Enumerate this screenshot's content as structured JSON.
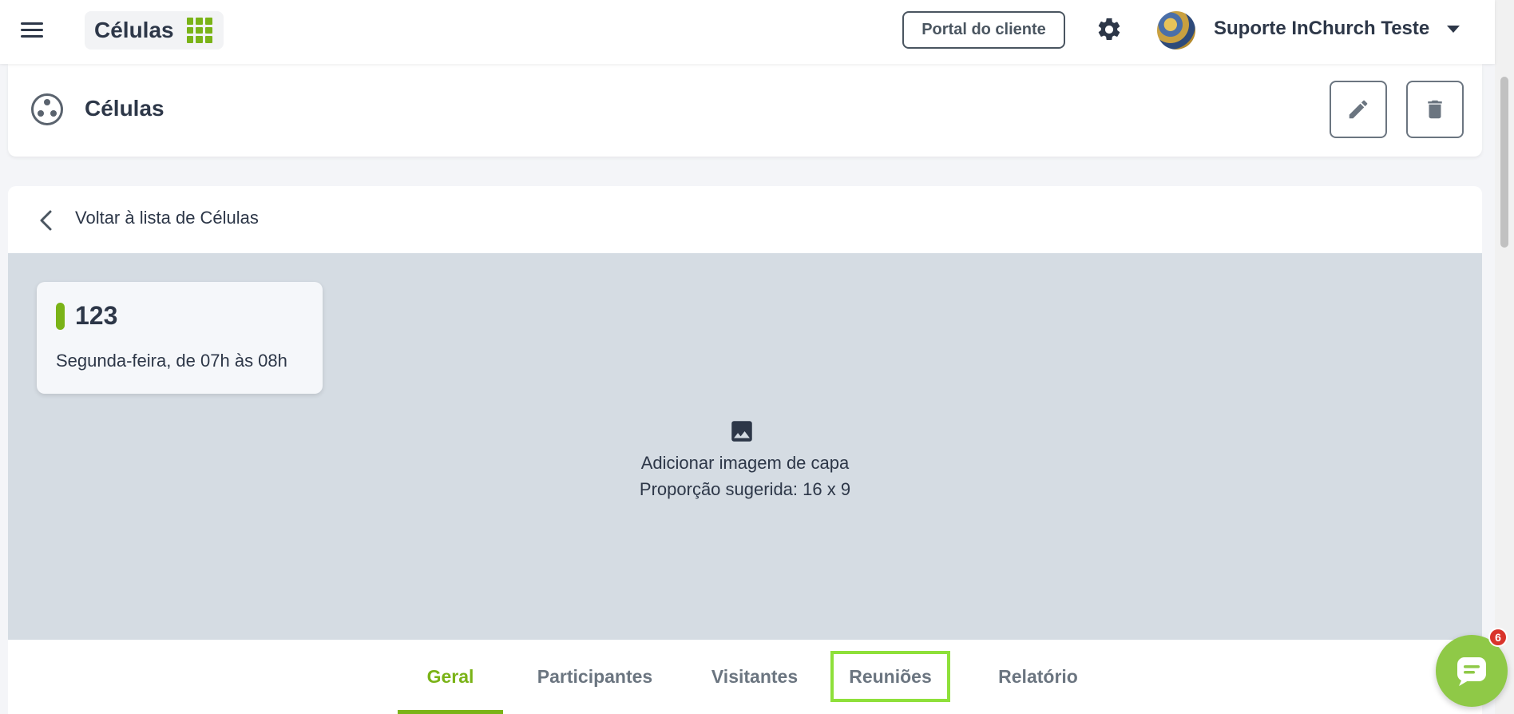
{
  "header": {
    "app_title": "Células",
    "portal_button": "Portal do cliente",
    "user_name": "Suporte InChurch Teste"
  },
  "page": {
    "title": "Células"
  },
  "detail": {
    "back_label": "Voltar à lista de Células",
    "cell": {
      "name": "123",
      "schedule": "Segunda-feira, de 07h às 08h"
    },
    "cover": {
      "add_label": "Adicionar imagem de capa",
      "ratio_label": "Proporção sugerida: 16 x 9"
    },
    "tabs": [
      {
        "label": "Geral",
        "active": true
      },
      {
        "label": "Participantes",
        "active": false
      },
      {
        "label": "Visitantes",
        "active": false
      },
      {
        "label": "Reuniões",
        "active": false
      },
      {
        "label": "Relatório",
        "active": false
      }
    ]
  },
  "chat": {
    "badge_count": "6"
  },
  "colors": {
    "accent": "#7ab317",
    "text": "#2d3748",
    "cover_bg": "#d5dce3",
    "badge": "#d9342b",
    "highlight": "#8ee03a"
  }
}
